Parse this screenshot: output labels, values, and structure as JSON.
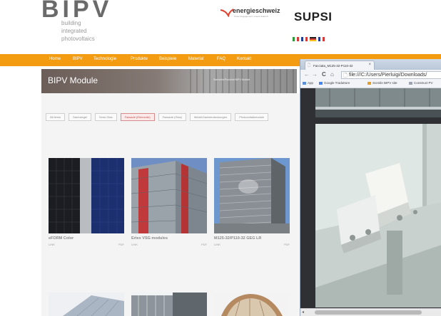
{
  "header": {
    "logo_mark": "BIPV",
    "logo_lines": [
      "building",
      "integrated",
      "photovoltaics"
    ],
    "partner_name": "energieschweiz",
    "partner_tagline": "Unser Engagement: unsere Zukunft",
    "supsi": "SUPSI",
    "languages": [
      {
        "code": "it",
        "colors": [
          "#2e9a3a",
          "#ffffff",
          "#d33a3a"
        ]
      },
      {
        "code": "fr",
        "colors": [
          "#1f3f9a",
          "#ffffff",
          "#d33a3a"
        ]
      },
      {
        "code": "de",
        "colors": [
          "#222222",
          "#d33a3a",
          "#f4c020"
        ]
      },
      {
        "code": "en",
        "colors": [
          "#233d8c",
          "#ffffff",
          "#d33a3a"
        ]
      }
    ]
  },
  "nav": {
    "items": [
      "Home",
      "BIPV",
      "Technologie",
      "Produkte",
      "Beispiele",
      "Material",
      "FAQ",
      "Kontakt"
    ]
  },
  "banner": {
    "title": "BIPV Module",
    "breadcrumb": "Startseite/Produkte/BIPV Module"
  },
  "filters": [
    "All items",
    "Dachziegel",
    "Semi-Glas",
    "Fassade (Elemente)",
    "Fassade (Glas)",
    "Metall-Dacheindeckungen",
    "Photovoltaikmodule"
  ],
  "active_filter": 3,
  "products": [
    {
      "title": "eFORM Color",
      "link": "LINK",
      "pdf": "PDF"
    },
    {
      "title": "Ertex VSG modules",
      "link": "LINK",
      "pdf": "PDF"
    },
    {
      "title": "M125-32/P110-32 GEG LR",
      "link": "LINK",
      "pdf": "PDF"
    }
  ],
  "browser": {
    "tab_title": "Facciata_M125-32-P110-32",
    "tab_close": "×",
    "back": "←",
    "forward": "→",
    "reload": "C",
    "home": "⌂",
    "url_icon": "🗋",
    "url": "file:///C:/Users/Pierluigi/Downloads/",
    "bookmarks": [
      {
        "label": "App",
        "color": "#5b8fd6"
      },
      {
        "label": "Google Traduttore",
        "color": "#4285f4"
      },
      {
        "label": "Scenile BIPV site",
        "color": "#e0a02a"
      },
      {
        "label": "Construct PV",
        "color": "#9aa5b1"
      }
    ]
  },
  "colors": {
    "nav_orange": "#f39c12",
    "active_chip": "#c05050"
  }
}
